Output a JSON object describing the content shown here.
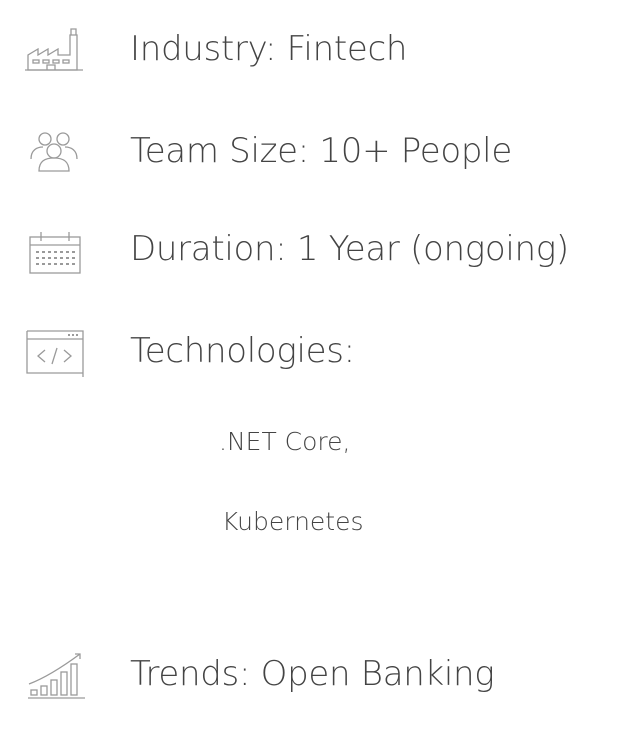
{
  "colors": {
    "text": "#444444",
    "icon": "#9a9a9a"
  },
  "items": [
    {
      "icon": "factory-icon",
      "label": "Industry: Fintech"
    },
    {
      "icon": "team-icon",
      "label": "Team Size: 10+ People"
    },
    {
      "icon": "calendar-icon",
      "label": "Duration: 1 Year (ongoing)"
    },
    {
      "icon": "code-window-icon",
      "label": "Technologies:"
    },
    {
      "icon": "trend-chart-icon",
      "label": "Trends: Open Banking"
    }
  ],
  "technologies": [
    ".NET Core,",
    "Kubernetes"
  ]
}
